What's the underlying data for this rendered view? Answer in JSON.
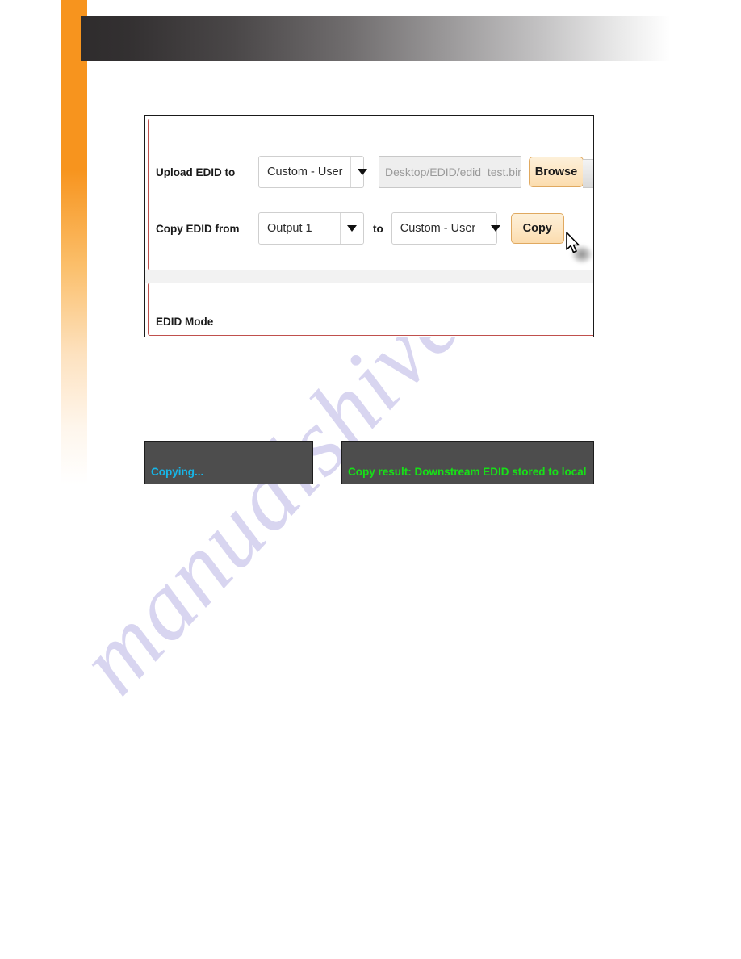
{
  "decor": {
    "orange_accent": "#f7941e",
    "header_dark": "#2f2c2d",
    "watermark_text": "manualshive.com",
    "watermark_color": "#b9b4e4"
  },
  "app": {
    "panel_border_color": "#c0504d",
    "upload_row": {
      "label": "Upload EDID to",
      "target_select": {
        "value": "Custom - User",
        "options": [
          "Custom - User"
        ],
        "arrow_icon": "chevron-down-icon"
      },
      "path_field": {
        "value": "Desktop/EDID/edid_test.bin",
        "placeholder": "Desktop/EDID/edid_test.bin"
      },
      "browse_button": "Browse"
    },
    "copy_row": {
      "label": "Copy EDID from",
      "source_select": {
        "value": "Output 1",
        "options": [
          "Output 1"
        ],
        "arrow_icon": "chevron-down-icon"
      },
      "to_label": "to",
      "target_select": {
        "value": "Custom - User",
        "options": [
          "Custom - User"
        ],
        "arrow_icon": "chevron-down-icon"
      },
      "copy_button": "Copy"
    },
    "edid_mode_label": "EDID Mode"
  },
  "status_messages": [
    {
      "text": "Copying...",
      "color": "#16b6e8",
      "background": "#4d4d4d"
    },
    {
      "text": "Copy result: Downstream EDID stored to local",
      "color": "#17e017",
      "background": "#4d4d4d"
    }
  ]
}
